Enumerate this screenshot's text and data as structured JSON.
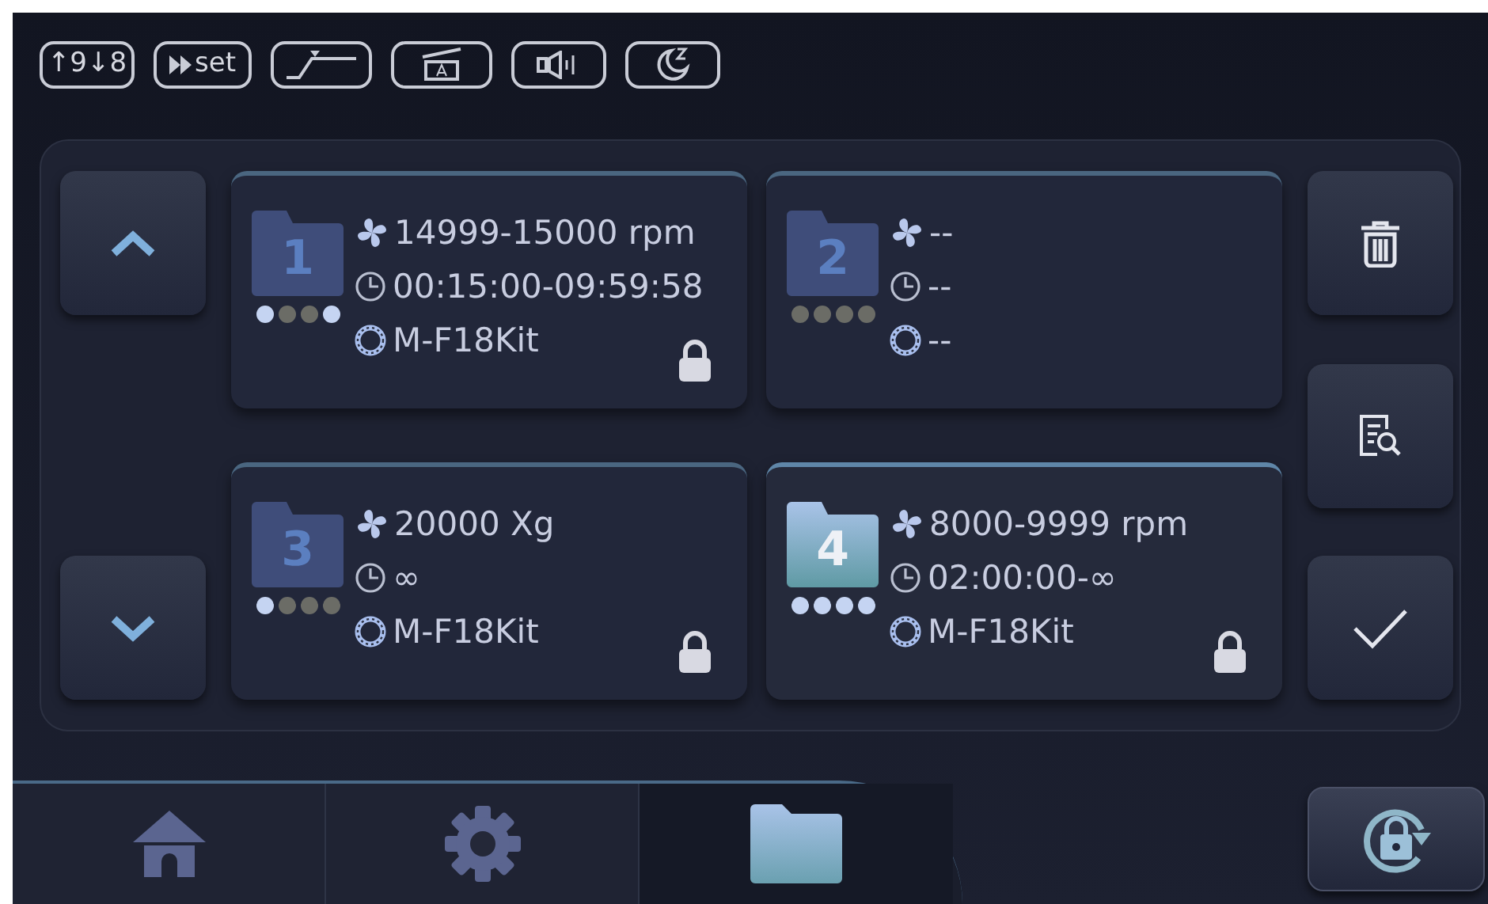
{
  "status_icons": [
    {
      "kind": "text",
      "label": "↑9↓8"
    },
    {
      "kind": "set",
      "label": "set"
    },
    {
      "kind": "ramp"
    },
    {
      "kind": "lid"
    },
    {
      "kind": "sound"
    },
    {
      "kind": "sleep"
    }
  ],
  "programs": [
    {
      "number": "1",
      "selected": false,
      "dots": [
        true,
        false,
        false,
        true
      ],
      "speed": "14999-15000 rpm",
      "time": "00:15:00-09:59:58",
      "rotor": "M-F18Kit",
      "locked": true
    },
    {
      "number": "2",
      "selected": false,
      "dots": [
        false,
        false,
        false,
        false
      ],
      "speed": "--",
      "time": "--",
      "rotor": "--",
      "locked": false
    },
    {
      "number": "3",
      "selected": false,
      "dots": [
        true,
        false,
        false,
        false
      ],
      "speed": "20000 Xg",
      "time": "∞",
      "rotor": "M-F18Kit",
      "locked": true
    },
    {
      "number": "4",
      "selected": true,
      "dots": [
        true,
        true,
        true,
        true
      ],
      "speed": "8000-9999 rpm",
      "time": "02:00:00-∞",
      "rotor": "M-F18Kit",
      "locked": true
    }
  ],
  "nav_tabs": [
    {
      "kind": "home",
      "selected": false
    },
    {
      "kind": "settings",
      "selected": false
    },
    {
      "kind": "folder",
      "selected": true
    }
  ]
}
